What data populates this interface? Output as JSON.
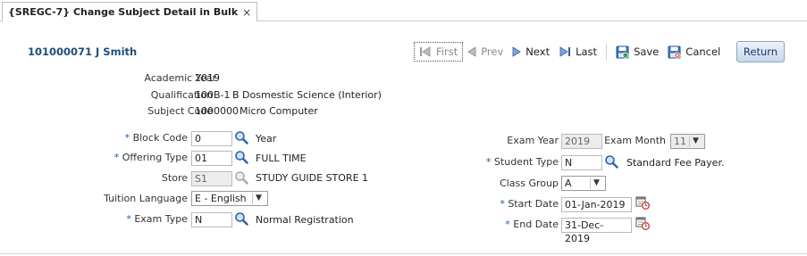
{
  "tab": {
    "title": "{SREGC-7} Change Subject Detail in Bulk",
    "close": "×"
  },
  "record": {
    "id_name": "101000071 J Smith"
  },
  "toolbar": {
    "first": "First",
    "prev": "Prev",
    "next": "Next",
    "last": "Last",
    "save": "Save",
    "cancel": "Cancel",
    "return": "Return"
  },
  "info": {
    "academic_year_label": "Academic Year",
    "academic_year": "2019",
    "qualification_label": "Qualification",
    "qualification_code": "100B-1",
    "qualification_name": "B Dosmestic Science (Interior)",
    "subject_code_label": "Subject Code",
    "subject_code": "1000000",
    "subject_name": "Micro Computer"
  },
  "left": {
    "required_mark": "*",
    "block_code_label": "Block Code",
    "block_code": "0",
    "block_code_desc": "Year",
    "offering_type_label": "Offering Type",
    "offering_type": "01",
    "offering_type_desc": "FULL TIME",
    "store_label": "Store",
    "store": "S1",
    "store_desc": "STUDY GUIDE STORE 1",
    "tuition_language_label": "Tuition Language",
    "tuition_language": "E - English",
    "exam_type_label": "Exam Type",
    "exam_type": "N",
    "exam_type_desc": "Normal Registration"
  },
  "right": {
    "required_mark": "*",
    "exam_year_label": "Exam Year",
    "exam_year": "2019",
    "exam_month_label": "Exam Month",
    "exam_month": "11",
    "student_type_label": "Student Type",
    "student_type": "N",
    "student_type_desc": "Standard Fee Payer.",
    "class_group_label": "Class Group",
    "class_group": "A",
    "start_date_label": "Start Date",
    "start_date": "01-Jan-2019",
    "end_date_label": "End Date",
    "end_date": "31-Dec-2019"
  },
  "icons": {
    "lookup": "magnifier-icon",
    "calendar": "calendar-icon",
    "save": "save-icon",
    "cancel": "cancel-icon"
  }
}
